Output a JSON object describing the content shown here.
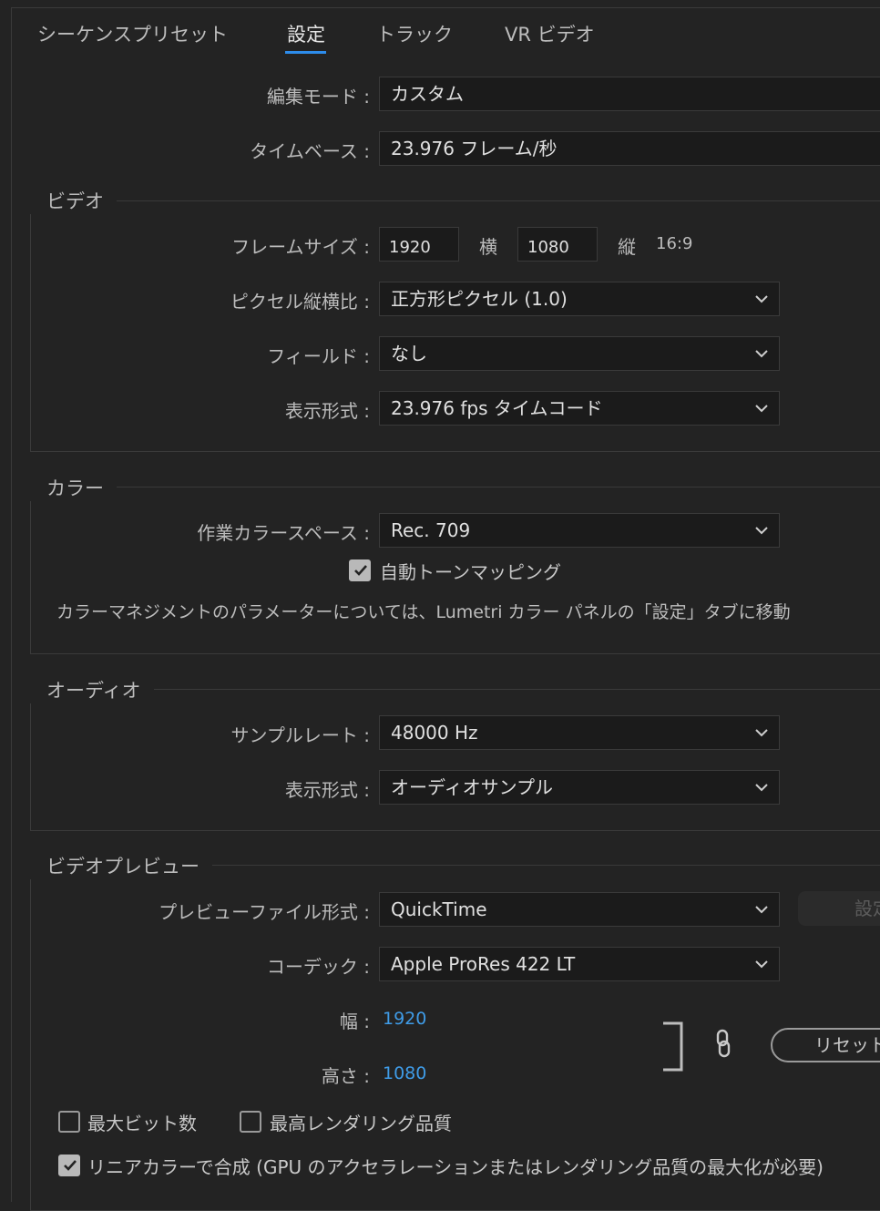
{
  "tabs": [
    "シーケンスプリセット",
    "設定",
    "トラック",
    "VR ビデオ"
  ],
  "active_tab": "設定",
  "edit_mode": {
    "label": "編集モード",
    "value": "カスタム"
  },
  "timebase": {
    "label": "タイムベース",
    "value": "23.976  フレーム/秒"
  },
  "colon": ":",
  "video": {
    "title": "ビデオ",
    "frame_size": {
      "label": "フレームサイズ",
      "width": "1920",
      "width_unit": "横",
      "height": "1080",
      "height_unit": "縦",
      "ratio": "16:9"
    },
    "pixel_aspect": {
      "label": "ピクセル縦横比",
      "value": "正方形ピクセル (1.0)"
    },
    "fields": {
      "label": "フィールド",
      "value": "なし"
    },
    "display_format": {
      "label": "表示形式",
      "value": "23.976 fps タイムコード"
    }
  },
  "color": {
    "title": "カラー",
    "working_space": {
      "label": "作業カラースペース",
      "value": "Rec. 709"
    },
    "auto_tone_mapping": {
      "label": "自動トーンマッピング",
      "checked": true
    },
    "note": "カラーマネジメントのパラメーターについては、Lumetri カラー パネルの「設定」タブに移動"
  },
  "audio": {
    "title": "オーディオ",
    "sample_rate": {
      "label": "サンプルレート",
      "value": "48000 Hz"
    },
    "display_format": {
      "label": "表示形式",
      "value": "オーディオサンプル"
    }
  },
  "video_preview": {
    "title": "ビデオプレビュー",
    "file_format": {
      "label": "プレビューファイル形式",
      "value": "QuickTime"
    },
    "settings_button": "設定",
    "codec": {
      "label": "コーデック",
      "value": "Apple ProRes 422 LT"
    },
    "width": {
      "label": "幅",
      "value": "1920"
    },
    "height": {
      "label": "高さ",
      "value": "1080"
    },
    "reset_button": "リセット"
  },
  "options": {
    "max_bit_depth": {
      "label": "最大ビット数",
      "checked": false
    },
    "max_render_quality": {
      "label": "最高レンダリング品質",
      "checked": false
    },
    "linear_color": {
      "label": "リニアカラーで合成 (GPU のアクセラレーションまたはレンダリング品質の最大化が必要)",
      "checked": true
    }
  },
  "colors": {
    "accent": "#2d8ceb",
    "link": "#3f9ce8",
    "background": "#232323",
    "field": "#1b1b1b"
  }
}
